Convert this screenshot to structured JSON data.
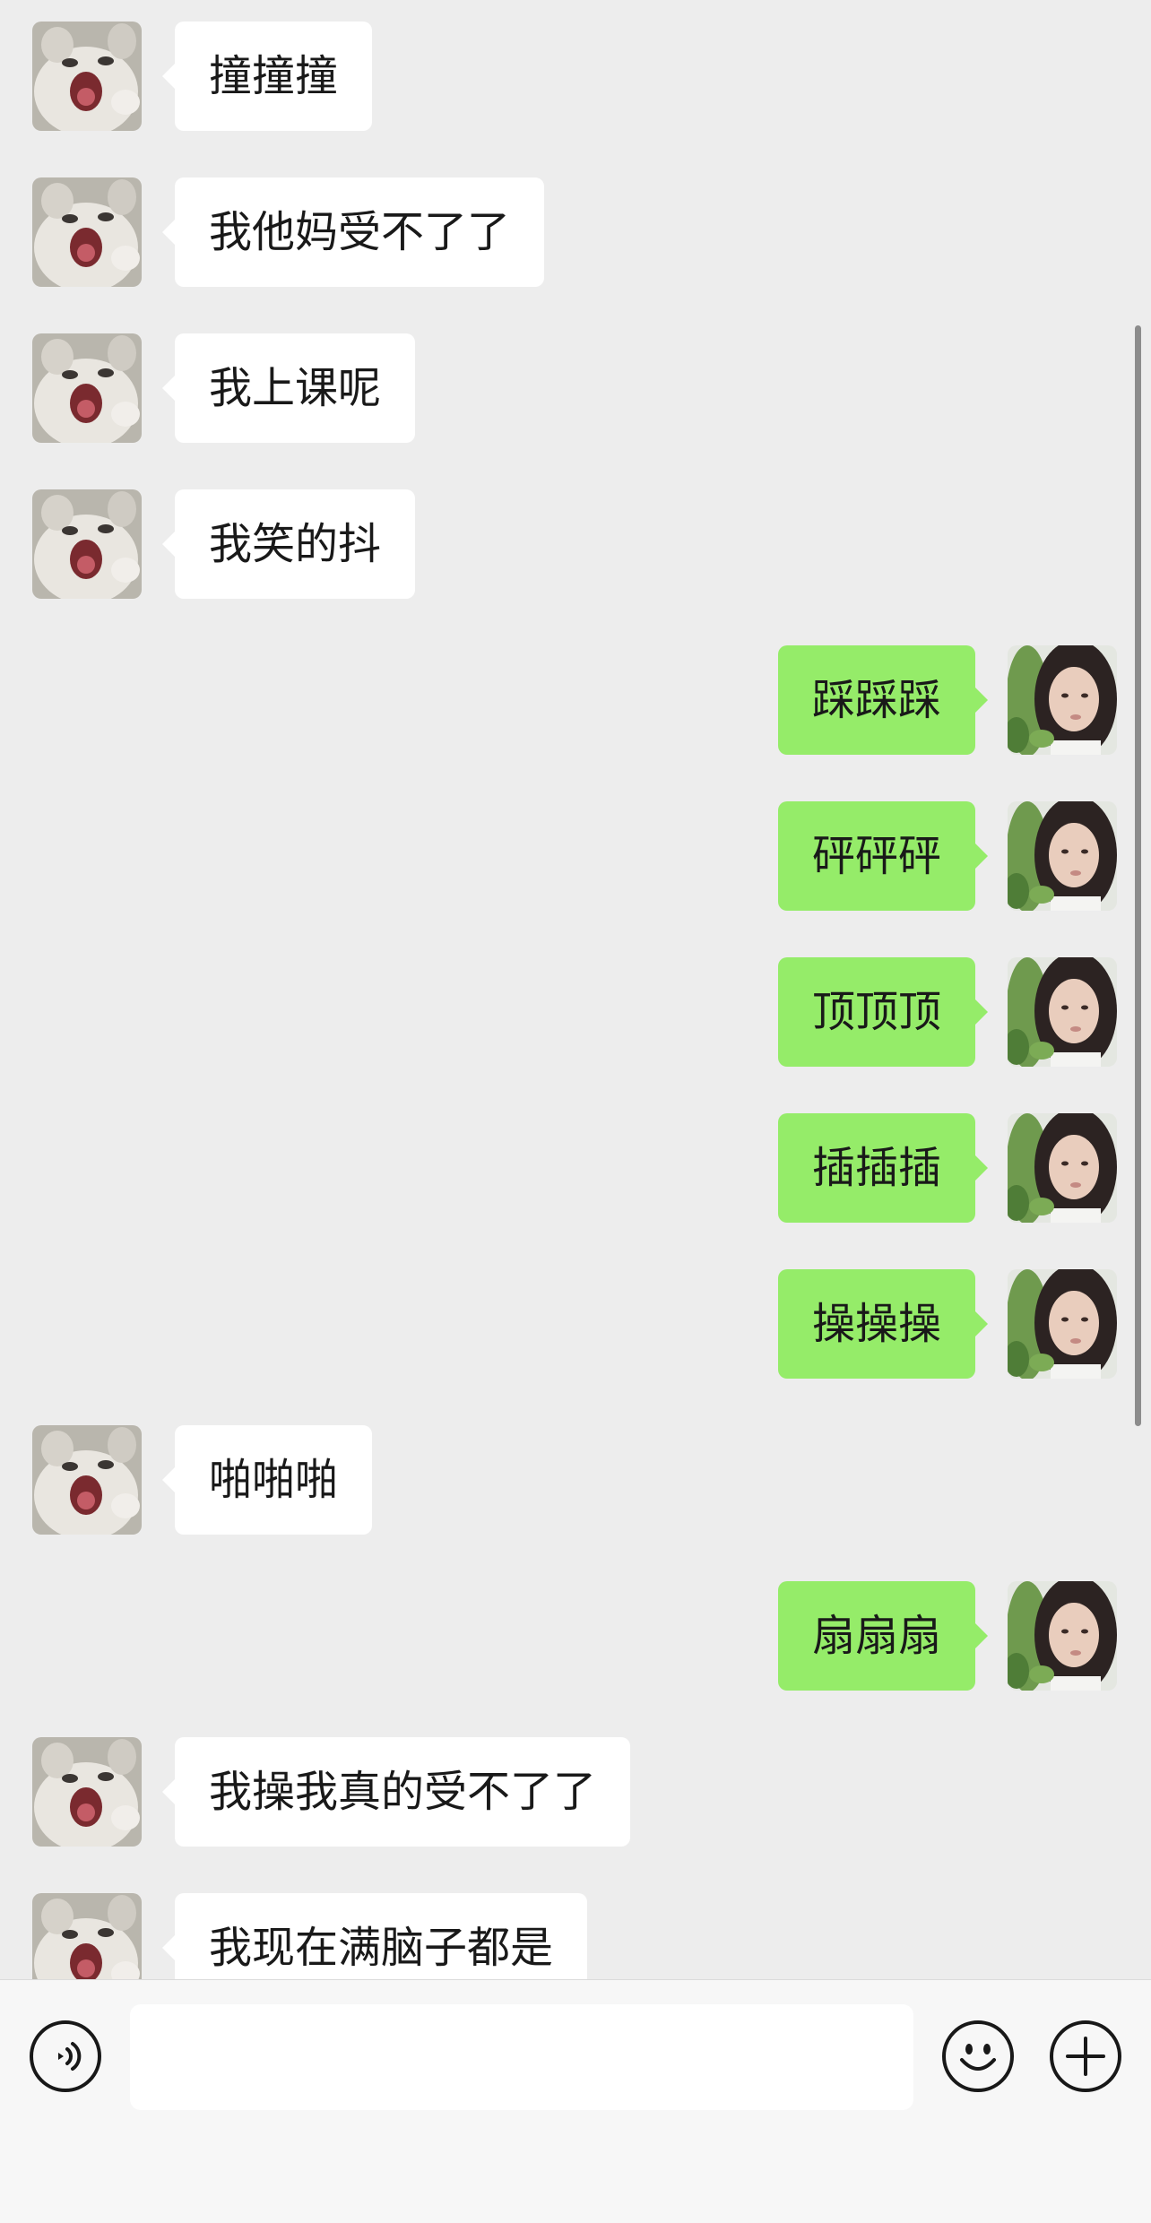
{
  "colors": {
    "background": "#ededed",
    "received_bubble": "#ffffff",
    "sent_bubble": "#95ec69",
    "input_bar": "#f7f7f7",
    "text": "#191919"
  },
  "chat": {
    "messages": [
      {
        "side": "received",
        "text": "撞撞撞",
        "avatar": "cat-avatar"
      },
      {
        "side": "received",
        "text": "我他妈受不了了",
        "avatar": "cat-avatar"
      },
      {
        "side": "received",
        "text": "我上课呢",
        "avatar": "cat-avatar"
      },
      {
        "side": "received",
        "text": "我笑的抖",
        "avatar": "cat-avatar"
      },
      {
        "side": "sent",
        "text": "踩踩踩",
        "avatar": "girl-avatar"
      },
      {
        "side": "sent",
        "text": "砰砰砰",
        "avatar": "girl-avatar"
      },
      {
        "side": "sent",
        "text": "顶顶顶",
        "avatar": "girl-avatar"
      },
      {
        "side": "sent",
        "text": "插插插",
        "avatar": "girl-avatar"
      },
      {
        "side": "sent",
        "text": "操操操",
        "avatar": "girl-avatar"
      },
      {
        "side": "received",
        "text": "啪啪啪",
        "avatar": "cat-avatar"
      },
      {
        "side": "sent",
        "text": "扇扇扇",
        "avatar": "girl-avatar"
      },
      {
        "side": "received",
        "text": "我操我真的受不了了",
        "avatar": "cat-avatar"
      },
      {
        "side": "received",
        "text": "我现在满脑子都是",
        "avatar": "cat-avatar"
      }
    ]
  },
  "input_bar": {
    "message_value": "",
    "voice_icon": "voice-icon",
    "emoji_icon": "smiley-icon",
    "more_icon": "plus-icon"
  }
}
